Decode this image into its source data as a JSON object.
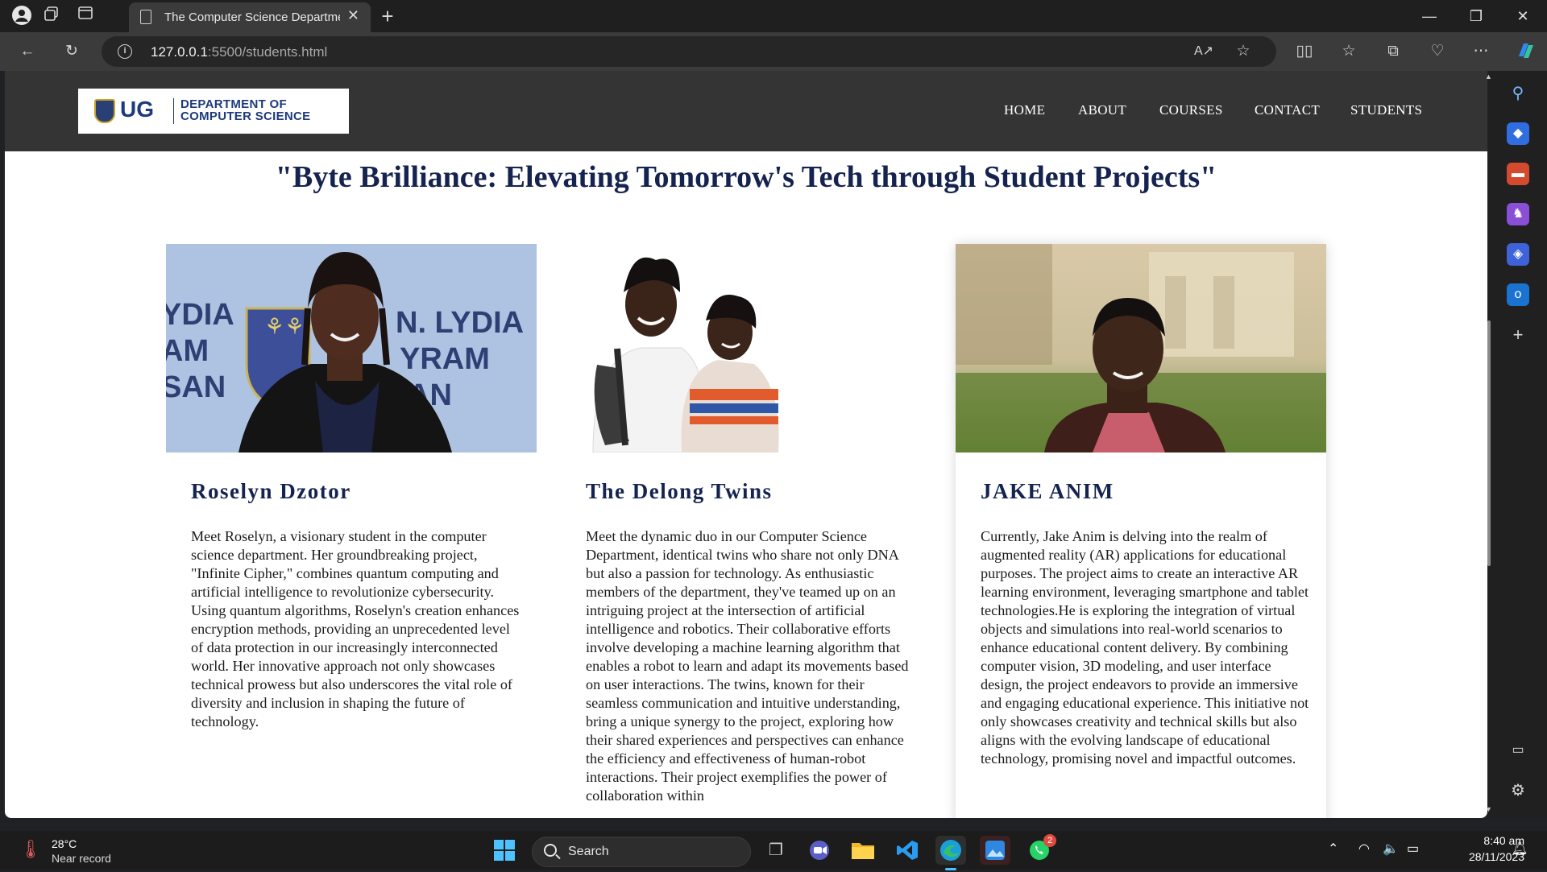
{
  "browser": {
    "tab_title": "The Computer Science Departme",
    "url_host": "127.0.0.1",
    "url_path": ":5500/students.html"
  },
  "site": {
    "logo": {
      "short": "UG",
      "line1": "DEPARTMENT OF",
      "line2": "COMPUTER SCIENCE"
    },
    "nav": [
      "HOME",
      "ABOUT",
      "COURSES",
      "CONTACT",
      "STUDENTS"
    ],
    "headline": "\"Byte Brilliance: Elevating Tomorrow's Tech through Student Projects\"",
    "colors": {
      "header_bg": "#343434",
      "heading_navy": "#14234f"
    },
    "students": [
      {
        "name": "Roselyn Dzotor",
        "text": "Meet Roselyn, a visionary student in the computer science department. Her groundbreaking project, \"Infinite Cipher,\" combines quantum computing and artificial intelligence to revolutionize cybersecurity. Using quantum algorithms, Roselyn's creation enhances encryption methods, providing an unprecedented level of data protection in our increasingly interconnected world. Her innovative approach not only showcases technical prowess but also underscores the vital role of diversity and inclusion in shaping the future of technology."
      },
      {
        "name": "The Delong Twins",
        "text": "Meet the dynamic duo in our Computer Science Department, identical twins who share not only DNA but also a passion for technology. As enthusiastic members of the department, they've teamed up on an intriguing project at the intersection of artificial intelligence and robotics. Their collaborative efforts involve developing a machine learning algorithm that enables a robot to learn and adapt its movements based on user interactions. The twins, known for their seamless communication and intuitive understanding, bring a unique synergy to the project, exploring how their shared experiences and perspectives can enhance the efficiency and effectiveness of human-robot interactions. Their project exemplifies the power of collaboration within"
      },
      {
        "name": "JAKE ANIM",
        "text": "Currently, Jake Anim is delving into the realm of augmented reality (AR) applications for educational purposes. The project aims to create an interactive AR learning environment, leveraging smartphone and tablet technologies.He is exploring the integration of virtual objects and simulations into real-world scenarios to enhance educational content delivery. By combining computer vision, 3D modeling, and user interface design, the project endeavors to provide an immersive and engaging educational experience. This initiative not only showcases creativity and technical skills but also aligns with the evolving landscape of educational technology, promising novel and impactful outcomes."
      }
    ],
    "photo_banner_text": {
      "left": "YDIA",
      "left2": "AM",
      "left3": "SAN",
      "right": "N. LYDIA",
      "right2": "YRAM",
      "right3": "AN"
    }
  },
  "taskbar": {
    "weather_temp": "28°C",
    "weather_desc": "Near record",
    "search_label": "Search",
    "time": "8:40 am",
    "date": "28/11/2023",
    "whatsapp_badge": "2"
  }
}
